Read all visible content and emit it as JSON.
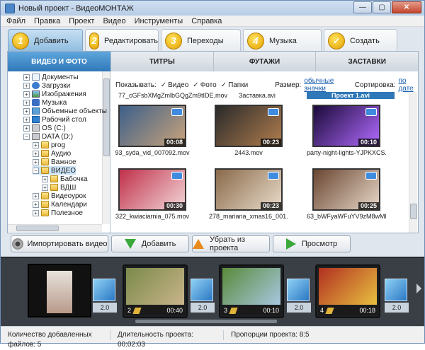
{
  "window": {
    "title": "Новый проект - ВидеоМОНТАЖ",
    "buttons": [
      "—",
      "▢",
      "✕"
    ]
  },
  "menu": [
    "Файл",
    "Правка",
    "Проект",
    "Видео",
    "Инструменты",
    "Справка"
  ],
  "steps": [
    {
      "num": "1",
      "label": "Добавить"
    },
    {
      "num": "2",
      "label": "Редактировать"
    },
    {
      "num": "3",
      "label": "Переходы"
    },
    {
      "num": "4",
      "label": "Музыка"
    },
    {
      "num": "✓",
      "label": "Создать"
    }
  ],
  "subtabs": [
    "ВИДЕО И ФОТО",
    "ТИТРЫ",
    "ФУТАЖИ",
    "ЗАСТАВКИ"
  ],
  "tree": [
    {
      "label": "Документы",
      "icon": "doc-icon",
      "pm": "+"
    },
    {
      "label": "Загрузки",
      "icon": "download-icon",
      "pm": "+"
    },
    {
      "label": "Изображения",
      "icon": "images-icon",
      "pm": "+"
    },
    {
      "label": "Музыка",
      "icon": "music-icon",
      "pm": "+"
    },
    {
      "label": "Объемные объекты",
      "icon": "cube-icon",
      "pm": "+"
    },
    {
      "label": "Рабочий стол",
      "icon": "desktop-icon",
      "pm": "+"
    },
    {
      "label": "OS (C:)",
      "icon": "drive-icon",
      "pm": "+"
    },
    {
      "label": "DATA (D:)",
      "icon": "drive-icon",
      "pm": "−"
    },
    {
      "label": "prog",
      "icon": "folder-icon",
      "pm": "+"
    },
    {
      "label": "Аудио",
      "icon": "folder-icon",
      "pm": "+"
    },
    {
      "label": "Важное",
      "icon": "folder-icon",
      "pm": "+"
    },
    {
      "label": "ВИДЕО",
      "icon": "folder-icon",
      "pm": "−"
    },
    {
      "label": "Бабочка",
      "icon": "folder-icon",
      "pm": "+"
    },
    {
      "label": "ВДШ",
      "icon": "folder-icon",
      "pm": "+"
    },
    {
      "label": "Видеоурок",
      "icon": "folder-icon",
      "pm": "+"
    },
    {
      "label": "Календари",
      "icon": "folder-icon",
      "pm": "+"
    },
    {
      "label": "Полезное",
      "icon": "folder-icon",
      "pm": "+"
    }
  ],
  "options": {
    "show_label": "Показывать:",
    "video": "Видео",
    "photo": "Фото",
    "folders": "Папки",
    "size_label": "Размер:",
    "size_value": "обычные значки",
    "sort_label": "Сортировка:",
    "sort_value": "по дате"
  },
  "gallery_top": [
    "77_cGFsbXMgZmlbGQgZm9tIDE.mov",
    "Заставка.avi",
    "Проект 1.avi"
  ],
  "gallery": [
    {
      "name": "93_syda_vid_007092.mov",
      "duration": "00:08",
      "colors": [
        "#3c5f8a",
        "#c9a37a"
      ]
    },
    {
      "name": "2443.mov",
      "duration": "00:23",
      "colors": [
        "#2a2a2a",
        "#b07d4e"
      ]
    },
    {
      "name": "party-night-lights-YJPKXCS.mov",
      "duration": "00:10",
      "colors": [
        "#1a0a3a",
        "#b26bff"
      ]
    },
    {
      "name": "322_kwiaciarnia_075.mov",
      "duration": "00:30",
      "colors": [
        "#c0304a",
        "#f2d6d8"
      ]
    },
    {
      "name": "278_mariana_xmas16_001.mov",
      "duration": "00:23",
      "colors": [
        "#8a6a4a",
        "#e9dccb"
      ]
    },
    {
      "name": "63_bWFyaWFuYV9zM8wMDE.mov",
      "duration": "00:25",
      "colors": [
        "#6a4632",
        "#e8d8c8"
      ]
    }
  ],
  "actions": {
    "import": "Импортировать видео",
    "add": "Добавить",
    "remove": "Убрать из проекта",
    "preview": "Просмотр"
  },
  "timeline": {
    "transitions": [
      "2.0",
      "2.0",
      "2.0",
      "2.0"
    ],
    "clips": [
      {
        "num": "2",
        "time": "00:40",
        "colors": [
          "#7a8a4a",
          "#c9b48a"
        ]
      },
      {
        "num": "3",
        "time": "00:10",
        "colors": [
          "#5a8a3a",
          "#a7c7e0"
        ]
      },
      {
        "num": "4",
        "time": "00:18",
        "colors": [
          "#b03020",
          "#e8c040"
        ]
      }
    ]
  },
  "status": {
    "files": "Количество добавленных файлов: 5",
    "duration": "Длительность проекта: 00:02:03",
    "aspect": "Пропорции проекта: 8:5"
  }
}
